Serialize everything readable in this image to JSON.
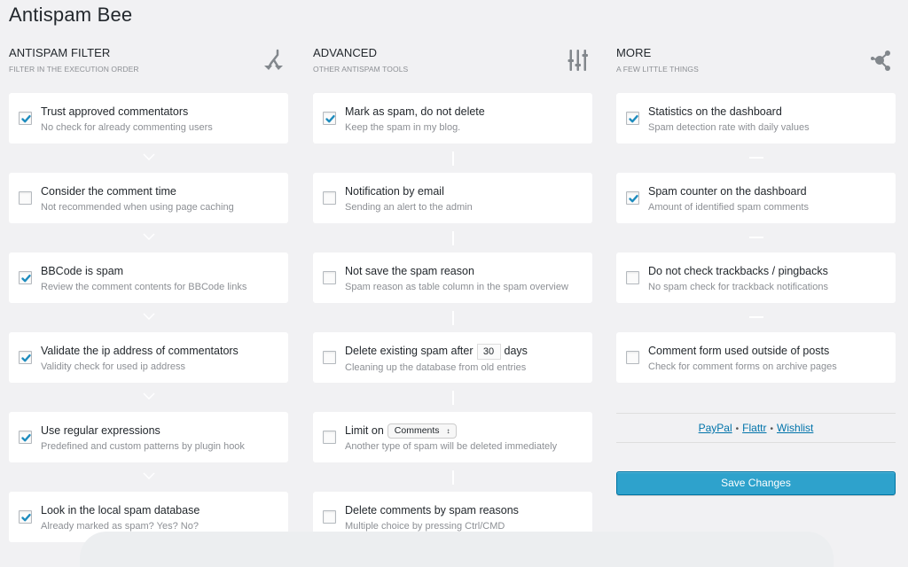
{
  "page": {
    "title": "Antispam Bee"
  },
  "colors": {
    "accent": "#2ea2cc",
    "checkmark": "#1e8cbe",
    "link": "#0073aa",
    "background": "#f1f1f3"
  },
  "columns": [
    {
      "title": "Antispam Filter",
      "subtitle": "Filter in the execution order",
      "icon": "merge-arrows-icon",
      "connector": "chevron-down",
      "items": [
        {
          "title": "Trust approved commentators",
          "description": "No check for already commenting users",
          "checked": true
        },
        {
          "title": "Consider the comment time",
          "description": "Not recommended when using page caching",
          "checked": false
        },
        {
          "title": "BBCode is spam",
          "description": "Review the comment contents for BBCode links",
          "checked": true
        },
        {
          "title": "Validate the ip address of commentators",
          "description": "Validity check for used ip address",
          "checked": true
        },
        {
          "title": "Use regular expressions",
          "description": "Predefined and custom patterns by plugin hook",
          "checked": true
        },
        {
          "title": "Look in the local spam database",
          "description": "Already marked as spam? Yes? No?",
          "checked": true
        }
      ]
    },
    {
      "title": "Advanced",
      "subtitle": "Other antispam tools",
      "icon": "sliders-icon",
      "connector": "vertical-line",
      "items": [
        {
          "title": "Mark as spam, do not delete",
          "description": "Keep the spam in my blog.",
          "checked": true
        },
        {
          "title": "Notification by email",
          "description": "Sending an alert to the admin",
          "checked": false
        },
        {
          "title": "Not save the spam reason",
          "description": "Spam reason as table column in the spam overview",
          "checked": false
        },
        {
          "title_before": "Delete existing spam after",
          "input_value": "30",
          "title_after": "days",
          "description": "Cleaning up the database from old entries",
          "checked": false
        },
        {
          "title_before": "Limit on",
          "select_value": "Comments",
          "description": "Another type of spam will be deleted immediately",
          "checked": false
        },
        {
          "title": "Delete comments by spam reasons",
          "description": "Multiple choice by pressing Ctrl/CMD",
          "checked": false
        }
      ]
    },
    {
      "title": "More",
      "subtitle": "A few little things",
      "icon": "share-icon",
      "connector": "horizontal-line",
      "items": [
        {
          "title": "Statistics on the dashboard",
          "description": "Spam detection rate with daily values",
          "checked": true
        },
        {
          "title": "Spam counter on the dashboard",
          "description": "Amount of identified spam comments",
          "checked": true
        },
        {
          "title": "Do not check trackbacks / pingbacks",
          "description": "No spam check for trackback notifications",
          "checked": false
        },
        {
          "title": "Comment form used outside of posts",
          "description": "Check for comment forms on archive pages",
          "checked": false
        }
      ]
    }
  ],
  "links": {
    "items": [
      "PayPal",
      "Flattr",
      "Wishlist"
    ],
    "separator": "•"
  },
  "save_button": {
    "label": "Save Changes"
  }
}
